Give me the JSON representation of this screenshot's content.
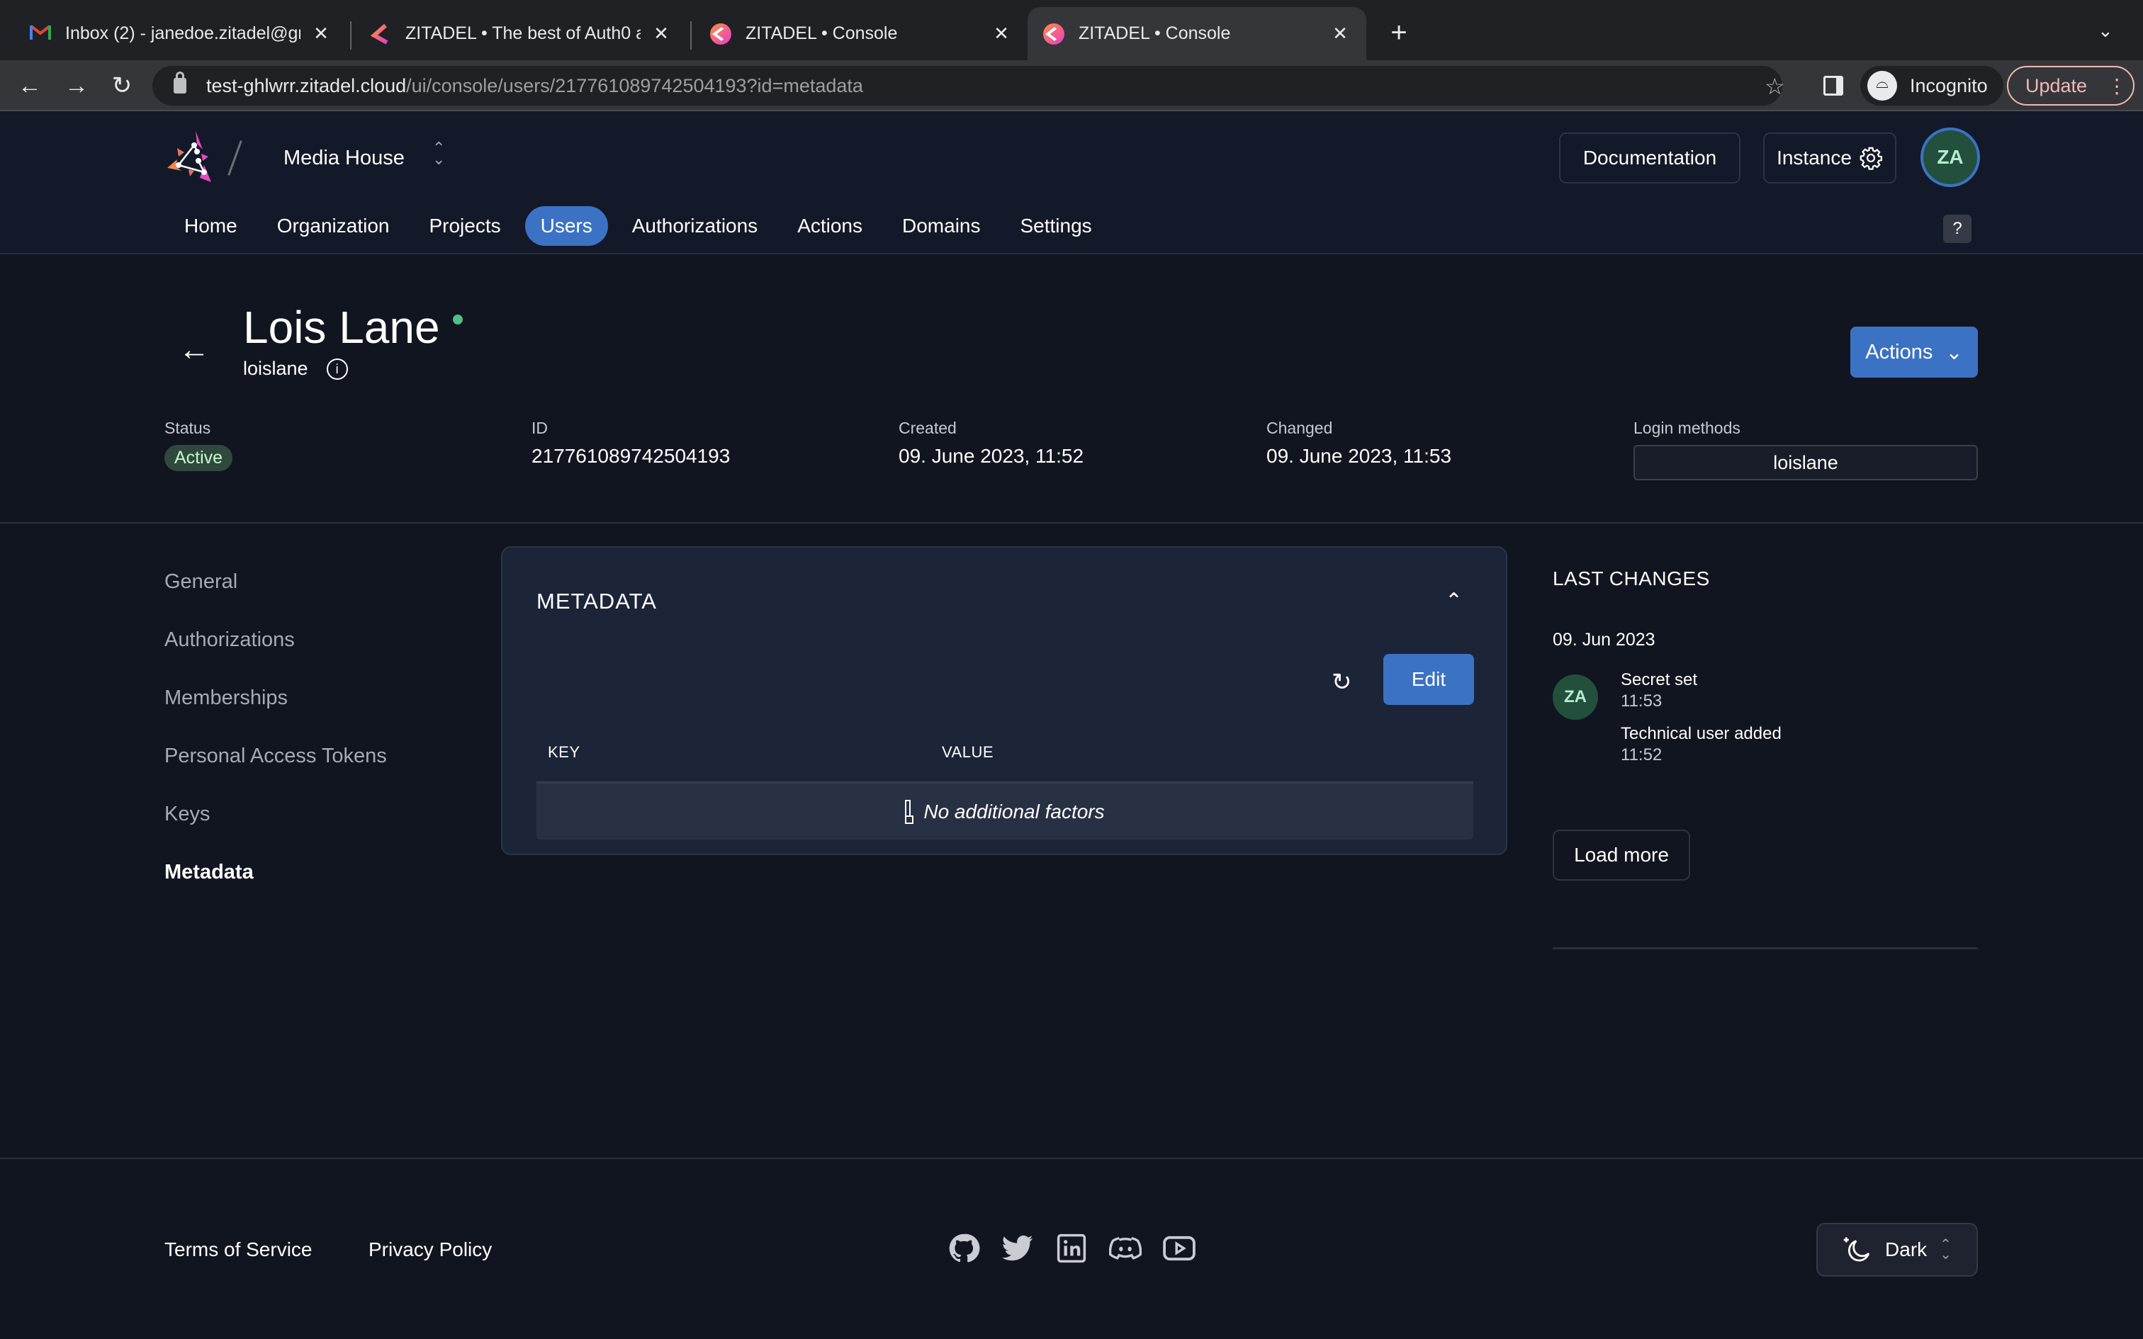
{
  "browser": {
    "tabs": [
      {
        "title": "Inbox (2) - janedoe.zitadel@gm",
        "icon": "gmail-icon",
        "active": false
      },
      {
        "title": "ZITADEL • The best of Auth0 a",
        "icon": "zitadel-icon",
        "active": false
      },
      {
        "title": "ZITADEL • Console",
        "icon": "zitadel-icon",
        "active": false
      },
      {
        "title": "ZITADEL • Console",
        "icon": "zitadel-icon",
        "active": true
      }
    ],
    "url_host": "test-ghlwrr.zitadel.cloud",
    "url_path": "/ui/console/users/217761089742504193?id=metadata",
    "incognito_label": "Incognito",
    "update_label": "Update"
  },
  "header": {
    "org_name": "Media House",
    "documentation_label": "Documentation",
    "instance_label": "Instance",
    "avatar_initials": "ZA",
    "help_label": "?",
    "nav": [
      {
        "label": "Home",
        "active": false
      },
      {
        "label": "Organization",
        "active": false
      },
      {
        "label": "Projects",
        "active": false
      },
      {
        "label": "Users",
        "active": true
      },
      {
        "label": "Authorizations",
        "active": false
      },
      {
        "label": "Actions",
        "active": false
      },
      {
        "label": "Domains",
        "active": false
      },
      {
        "label": "Settings",
        "active": false
      }
    ]
  },
  "user": {
    "display_name": "Lois Lane",
    "login_name": "loislane",
    "online_status_color": "#4fbf85",
    "actions_label": "Actions",
    "meta": {
      "status_label": "Status",
      "status_value": "Active",
      "id_label": "ID",
      "id_value": "217761089742504193",
      "created_label": "Created",
      "created_value": "09. June 2023, 11:52",
      "changed_label": "Changed",
      "changed_value": "09. June 2023, 11:53",
      "login_methods_label": "Login methods",
      "login_methods_value": "loislane"
    }
  },
  "sidenav": {
    "items": [
      {
        "label": "General",
        "active": false
      },
      {
        "label": "Authorizations",
        "active": false
      },
      {
        "label": "Memberships",
        "active": false
      },
      {
        "label": "Personal Access Tokens",
        "active": false
      },
      {
        "label": "Keys",
        "active": false
      },
      {
        "label": "Metadata",
        "active": true
      }
    ]
  },
  "metadata_card": {
    "title": "METADATA",
    "edit_label": "Edit",
    "columns": [
      "KEY",
      "VALUE"
    ],
    "rows": [],
    "empty_text": "No additional factors"
  },
  "last_changes": {
    "title": "LAST CHANGES",
    "date": "09. Jun 2023",
    "avatar_initials": "ZA",
    "items": [
      {
        "event": "Secret set",
        "time": "11:53"
      },
      {
        "event": "Technical user added",
        "time": "11:52"
      }
    ],
    "load_more_label": "Load more"
  },
  "footer": {
    "terms_label": "Terms of Service",
    "privacy_label": "Privacy Policy",
    "social": [
      "github-icon",
      "twitter-icon",
      "linkedin-icon",
      "discord-icon",
      "youtube-icon"
    ],
    "theme_label": "Dark"
  },
  "colors": {
    "accent": "#3b72c4",
    "background": "#111520",
    "card": "#1c2438",
    "avatar_bg": "#22503d",
    "active_badge_bg": "#2f4a3d"
  }
}
